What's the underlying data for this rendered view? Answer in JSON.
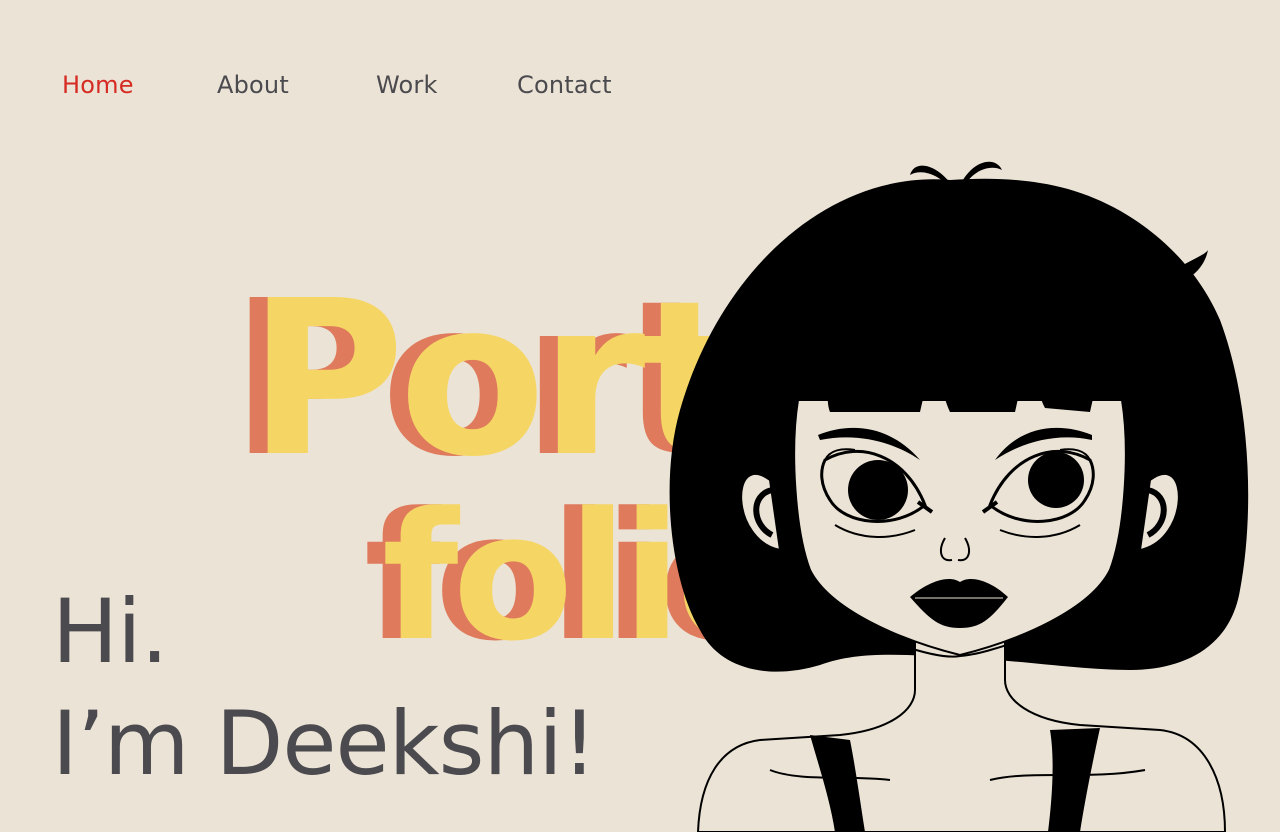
{
  "nav": {
    "items": [
      {
        "label": "Home",
        "active": true
      },
      {
        "label": "About",
        "active": false
      },
      {
        "label": "Work",
        "active": false
      },
      {
        "label": "Contact",
        "active": false
      }
    ]
  },
  "hero": {
    "display_line_1": "Portfolio",
    "display_line_2": "folio",
    "greeting_line_1": "Hi.",
    "greeting_line_2": "I’m Deekshi!"
  },
  "colors": {
    "background": "#ebe3d6",
    "text": "#4b4a4e",
    "active_link": "#d52b22",
    "display_fill": "#f5d665",
    "display_shadow": "#df7b5c",
    "illustration_ink": "#000000"
  },
  "illustration": {
    "icon": "girl-portrait-illustration"
  }
}
